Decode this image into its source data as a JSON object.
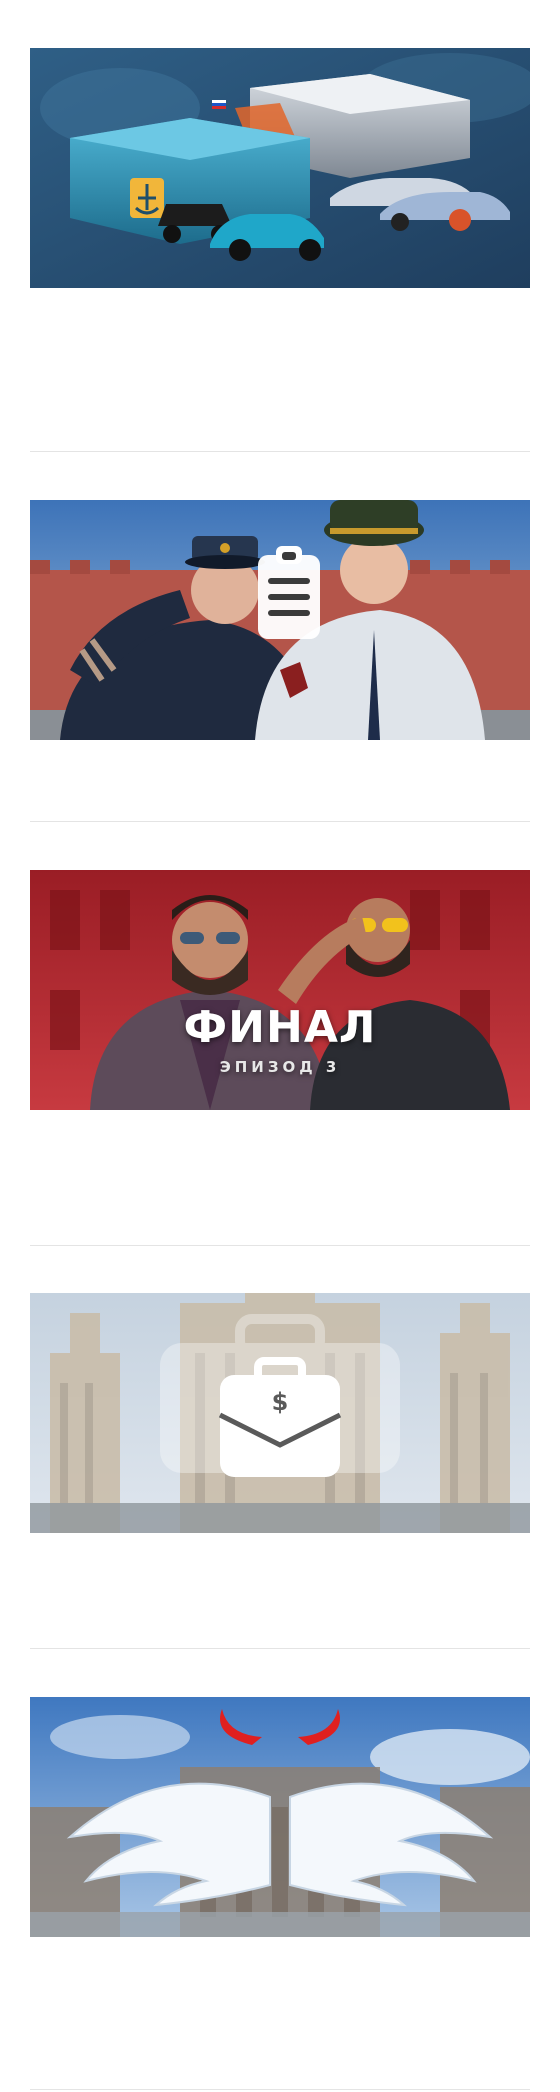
{
  "feed": {
    "cards": [
      {
        "overlay_title": "",
        "overlay_subtitle": ""
      },
      {
        "overlay_title": "",
        "overlay_subtitle": ""
      },
      {
        "overlay_title": "ФИНАЛ",
        "overlay_subtitle": "ЭПИЗОД 3"
      },
      {
        "overlay_title": "",
        "overlay_subtitle": ""
      },
      {
        "overlay_title": "",
        "overlay_subtitle": ""
      }
    ],
    "icons": {
      "card_1": "treasure-chest-cars-icon",
      "card_2": "clipboard-icon",
      "card_3": "",
      "card_4": "briefcase-dollar-icon",
      "card_5": "angel-wings-devil-horns-icon"
    },
    "briefcase_symbol": "$"
  },
  "colors": {
    "divider": "#e4e4e4",
    "chest_blue": "#2b86a8",
    "red_wall": "#b2252e",
    "sky_blue": "#3d73b8"
  }
}
